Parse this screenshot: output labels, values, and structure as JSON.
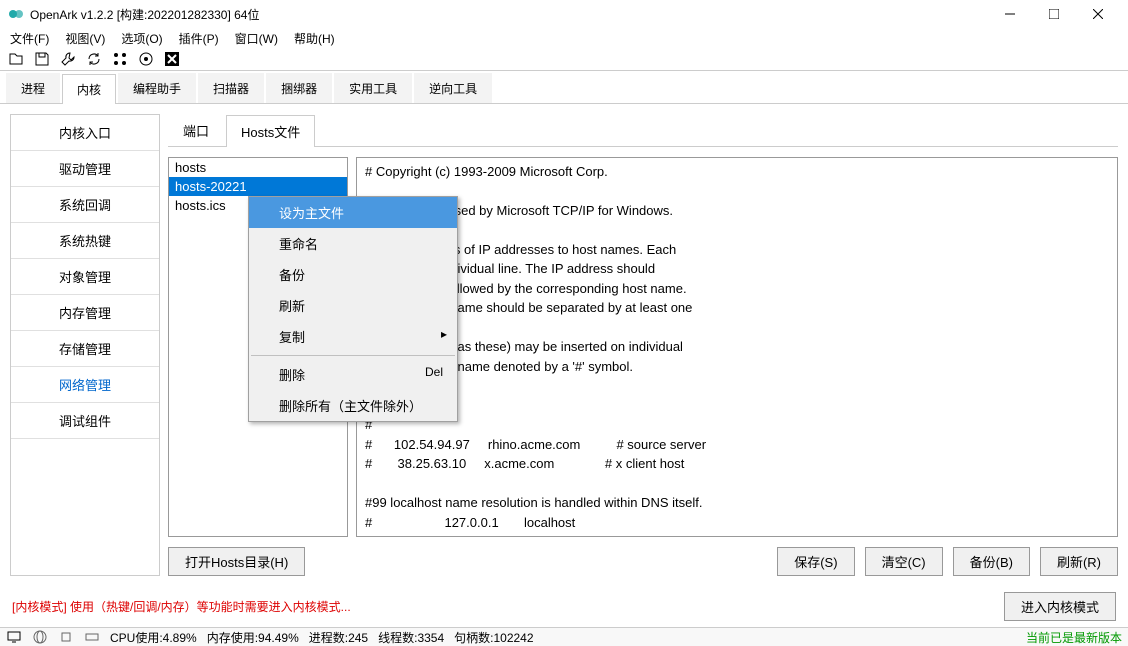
{
  "window": {
    "title": "OpenArk v1.2.2  [构建:202201282330]  64位"
  },
  "menubar": [
    "文件(F)",
    "视图(V)",
    "选项(O)",
    "插件(P)",
    "窗口(W)",
    "帮助(H)"
  ],
  "tabs1": [
    "进程",
    "内核",
    "编程助手",
    "扫描器",
    "捆绑器",
    "实用工具",
    "逆向工具"
  ],
  "tabs1_active": 1,
  "sidebar": [
    "内核入口",
    "驱动管理",
    "系统回调",
    "系统热键",
    "对象管理",
    "内存管理",
    "存储管理",
    "网络管理",
    "调试组件"
  ],
  "sidebar_active": 7,
  "tabs2": [
    "端口",
    "Hosts文件"
  ],
  "tabs2_active": 1,
  "files": [
    "hosts",
    "hosts-20221",
    "hosts.ics"
  ],
  "files_sel": 1,
  "hosts_text": "# Copyright (c) 1993-2009 Microsoft Corp.\n\nle HOSTS file used by Microsoft TCP/IP for Windows.\n\nns the mappings of IP addresses to host names. Each\ne kept on an individual line. The IP address should\ne first column followed by the corresponding host name.\ns and the host name should be separated by at least one\n\nomments (such as these) may be inserted on individual\nng the machine name denoted by a '#' symbol.\n#\n# For example:\n#\n#      102.54.94.97     rhino.acme.com          # source server\n#       38.25.63.10     x.acme.com              # x client host\n\n#99 localhost name resolution is handled within DNS itself.\n#                    127.0.0.1       localhost",
  "buttons": {
    "open": "打开Hosts目录(H)",
    "save": "保存(S)",
    "clear": "清空(C)",
    "backup": "备份(B)",
    "refresh": "刷新(R)",
    "enter": "进入内核模式"
  },
  "warning": "[内核模式] 使用（热键/回调/内存）等功能时需要进入内核模式...",
  "context_menu": [
    {
      "label": "设为主文件",
      "hl": true
    },
    {
      "label": "重命名"
    },
    {
      "label": "备份"
    },
    {
      "label": "刷新"
    },
    {
      "label": "复制",
      "arrow": "▸"
    },
    {
      "sep": true
    },
    {
      "label": "删除",
      "hint": "Del"
    },
    {
      "label": "删除所有（主文件除外）"
    }
  ],
  "status": {
    "cpu": "CPU使用:4.89%",
    "mem": "内存使用:94.49%",
    "proc": "进程数:245",
    "thread": "线程数:3354",
    "handle": "句柄数:102242",
    "version": "当前已是最新版本"
  }
}
